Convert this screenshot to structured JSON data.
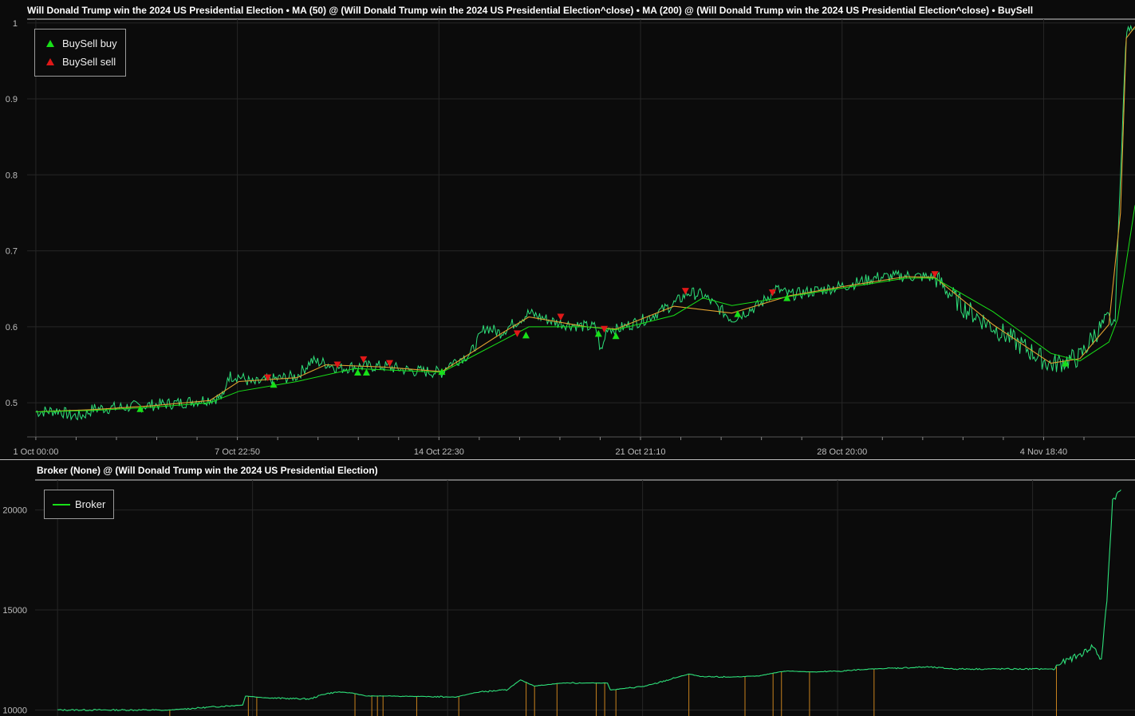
{
  "top_panel": {
    "title": "Will Donald Trump win the 2024 US Presidential Election  •  MA (50) @ (Will Donald Trump win the 2024 US Presidential Election^close)  •  MA (200) @ (Will Donald Trump win the 2024 US Presidential Election^close)  •  BuySell",
    "legend": {
      "buy_label": "BuySell buy",
      "sell_label": "BuySell sell"
    }
  },
  "bottom_panel": {
    "title": "Broker (None) @ (Will Donald Trump win the 2024 US Presidential Election)",
    "legend": {
      "broker_label": "Broker"
    }
  },
  "colors": {
    "price": "#2ee07a",
    "ma50": "#e0a030",
    "ma200": "#18e018",
    "buy": "#18e018",
    "sell": "#e01818",
    "broker": "#2ee07a",
    "broker_drops": "#c8821e",
    "grid": "#262626"
  },
  "chart_data": [
    {
      "type": "line",
      "x_ticks": [
        "1 Oct 00:00",
        "7 Oct 22:50",
        "14 Oct 22:30",
        "21 Oct 21:10",
        "28 Oct 20:00",
        "4 Nov 18:40"
      ],
      "y_ticks": [
        "0.5",
        "0.6",
        "0.7",
        "0.8",
        "0.9",
        "1"
      ],
      "ylim": [
        0.455,
        1.005
      ],
      "x_range_days": [
        -0.3,
        37.9
      ],
      "series": [
        {
          "name": "price",
          "role": "close",
          "points": [
            [
              0,
              0.488
            ],
            [
              0.8,
              0.49
            ],
            [
              1.2,
              0.483
            ],
            [
              1.6,
              0.483
            ],
            [
              2,
              0.492
            ],
            [
              3,
              0.494
            ],
            [
              4,
              0.497
            ],
            [
              5,
              0.5
            ],
            [
              6,
              0.505
            ],
            [
              6.5,
              0.508
            ],
            [
              6.6,
              0.535
            ],
            [
              7,
              0.535
            ],
            [
              7.5,
              0.525
            ],
            [
              8,
              0.53
            ],
            [
              9,
              0.535
            ],
            [
              9.5,
              0.555
            ],
            [
              10,
              0.552
            ],
            [
              10.5,
              0.545
            ],
            [
              11,
              0.548
            ],
            [
              12,
              0.548
            ],
            [
              13,
              0.542
            ],
            [
              14,
              0.54
            ],
            [
              14.2,
              0.55
            ],
            [
              15,
              0.565
            ],
            [
              15.5,
              0.6
            ],
            [
              16,
              0.592
            ],
            [
              17,
              0.618
            ],
            [
              18,
              0.605
            ],
            [
              19,
              0.6
            ],
            [
              19.3,
              0.6
            ],
            [
              19.5,
              0.565
            ],
            [
              19.7,
              0.6
            ],
            [
              20,
              0.596
            ],
            [
              21,
              0.61
            ],
            [
              22,
              0.63
            ],
            [
              22.5,
              0.645
            ],
            [
              23,
              0.642
            ],
            [
              24,
              0.61
            ],
            [
              25,
              0.63
            ],
            [
              25.5,
              0.65
            ],
            [
              26,
              0.642
            ],
            [
              27,
              0.648
            ],
            [
              28,
              0.655
            ],
            [
              29,
              0.665
            ],
            [
              30,
              0.667
            ],
            [
              31,
              0.665
            ],
            [
              32,
              0.625
            ],
            [
              33,
              0.6
            ],
            [
              34,
              0.575
            ],
            [
              35,
              0.55
            ],
            [
              36,
              0.56
            ],
            [
              36.5,
              0.59
            ],
            [
              37,
              0.61
            ],
            [
              37.2,
              0.6
            ],
            [
              37.4,
              0.8
            ],
            [
              37.6,
              0.99
            ],
            [
              37.9,
              0.995
            ]
          ]
        },
        {
          "name": "MA (50)",
          "role": "ma50",
          "points": [
            [
              0,
              0.488
            ],
            [
              2,
              0.491
            ],
            [
              4,
              0.496
            ],
            [
              6,
              0.503
            ],
            [
              7,
              0.528
            ],
            [
              9,
              0.533
            ],
            [
              10,
              0.55
            ],
            [
              12,
              0.547
            ],
            [
              14,
              0.541
            ],
            [
              16,
              0.59
            ],
            [
              17,
              0.613
            ],
            [
              19,
              0.6
            ],
            [
              20,
              0.597
            ],
            [
              22,
              0.627
            ],
            [
              24,
              0.618
            ],
            [
              26,
              0.641
            ],
            [
              28,
              0.654
            ],
            [
              30,
              0.666
            ],
            [
              31,
              0.665
            ],
            [
              33,
              0.603
            ],
            [
              35,
              0.552
            ],
            [
              36,
              0.558
            ],
            [
              37,
              0.603
            ],
            [
              37.4,
              0.75
            ],
            [
              37.6,
              0.98
            ],
            [
              37.9,
              0.995
            ]
          ]
        },
        {
          "name": "MA (200)",
          "role": "ma200",
          "points": [
            [
              0,
              0.488
            ],
            [
              2,
              0.49
            ],
            [
              4,
              0.494
            ],
            [
              6,
              0.5
            ],
            [
              7,
              0.515
            ],
            [
              9,
              0.528
            ],
            [
              11,
              0.545
            ],
            [
              14,
              0.54
            ],
            [
              15,
              0.56
            ],
            [
              16,
              0.58
            ],
            [
              17,
              0.6
            ],
            [
              19,
              0.6
            ],
            [
              20,
              0.596
            ],
            [
              22,
              0.615
            ],
            [
              23,
              0.638
            ],
            [
              24,
              0.628
            ],
            [
              26,
              0.64
            ],
            [
              28,
              0.652
            ],
            [
              30,
              0.664
            ],
            [
              31,
              0.664
            ],
            [
              33,
              0.62
            ],
            [
              35,
              0.565
            ],
            [
              36,
              0.555
            ],
            [
              37,
              0.58
            ],
            [
              37.3,
              0.61
            ],
            [
              37.9,
              0.76
            ]
          ]
        }
      ],
      "buy_markers": [
        [
          3.6,
          0.492
        ],
        [
          8.2,
          0.524
        ],
        [
          11.1,
          0.54
        ],
        [
          11.4,
          0.54
        ],
        [
          14,
          0.541
        ],
        [
          16.9,
          0.589
        ],
        [
          19.4,
          0.591
        ],
        [
          20,
          0.588
        ],
        [
          24.2,
          0.617
        ],
        [
          25.9,
          0.638
        ],
        [
          35.5,
          0.552
        ]
      ],
      "sell_markers": [
        [
          8,
          0.533
        ],
        [
          10.4,
          0.55
        ],
        [
          11.3,
          0.557
        ],
        [
          12.2,
          0.552
        ],
        [
          16.6,
          0.591
        ],
        [
          18.1,
          0.613
        ],
        [
          19.6,
          0.597
        ],
        [
          22.4,
          0.647
        ],
        [
          25.4,
          0.645
        ],
        [
          31,
          0.669
        ]
      ]
    },
    {
      "type": "line",
      "y_ticks": [
        "10000",
        "15000",
        "20000"
      ],
      "ylim": [
        9700,
        21500
      ],
      "series": [
        {
          "name": "Broker",
          "role": "broker",
          "points": [
            [
              0,
              10000
            ],
            [
              3.6,
              10000
            ],
            [
              3.7,
              9980
            ],
            [
              4,
              10000
            ],
            [
              6,
              10200
            ],
            [
              6.6,
              10250
            ],
            [
              6.7,
              10700
            ],
            [
              7.5,
              10600
            ],
            [
              9,
              10550
            ],
            [
              9.5,
              10800
            ],
            [
              10,
              10900
            ],
            [
              10.5,
              10850
            ],
            [
              11,
              10700
            ],
            [
              12,
              10700
            ],
            [
              14,
              10650
            ],
            [
              14.2,
              10650
            ],
            [
              15,
              10900
            ],
            [
              16,
              11000
            ],
            [
              16.5,
              11500
            ],
            [
              17,
              11200
            ],
            [
              18,
              11350
            ],
            [
              19,
              11350
            ],
            [
              19.6,
              11350
            ],
            [
              19.7,
              11000
            ],
            [
              21,
              11200
            ],
            [
              22,
              11600
            ],
            [
              22.5,
              11800
            ],
            [
              23,
              11650
            ],
            [
              24,
              11650
            ],
            [
              25,
              11700
            ],
            [
              25.7,
              11900
            ],
            [
              26,
              11950
            ],
            [
              27,
              11900
            ],
            [
              28,
              11950
            ],
            [
              29,
              12050
            ],
            [
              30,
              12100
            ],
            [
              31,
              12150
            ],
            [
              32,
              12050
            ],
            [
              35.5,
              12050
            ],
            [
              35.7,
              12300
            ],
            [
              36.5,
              12800
            ],
            [
              36.9,
              13200
            ],
            [
              37.2,
              12500
            ],
            [
              37.4,
              15500
            ],
            [
              37.6,
              20500
            ],
            [
              37.9,
              21000
            ]
          ]
        }
      ],
      "drops_to_baseline_days": [
        4,
        6.8,
        7.1,
        10.6,
        11.2,
        11.4,
        11.6,
        12.8,
        14.3,
        16.7,
        17,
        17.8,
        19.2,
        19.5,
        19.9,
        22.5,
        24.5,
        25.5,
        25.8,
        26.8,
        29.1,
        35.6
      ]
    }
  ]
}
